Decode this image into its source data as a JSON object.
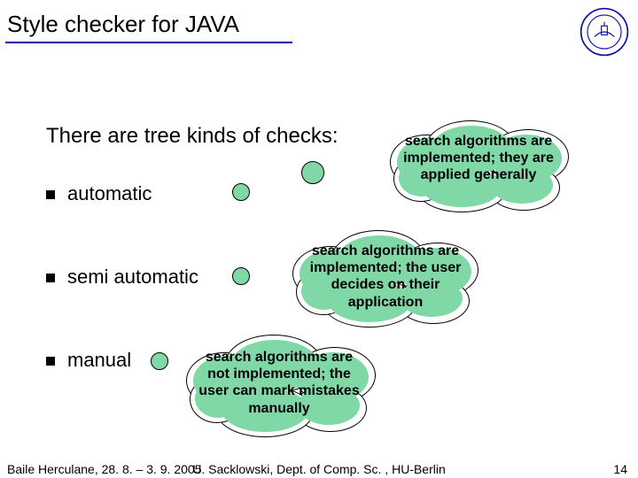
{
  "title": "Style checker for JAVA",
  "intro": "There are tree kinds of checks:",
  "bullets": {
    "b1": "automatic",
    "b2": "semi automatic",
    "b3": "manual"
  },
  "clouds": {
    "c1": "search algorithms are implemented; they are applied generally",
    "c2": "search algorithms are implemented; the user decides on their application",
    "c3": "search algorithms are not implemented; the user can mark mistakes manually"
  },
  "footer": {
    "left": "Baile Herculane, 28. 8. – 3. 9. 2005",
    "center": "U. Sacklowski, Dept. of Comp. Sc. , HU-Berlin",
    "right": "14"
  }
}
